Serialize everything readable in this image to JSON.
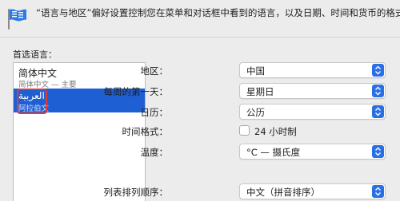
{
  "header": {
    "description": "“语言与地区”偏好设置控制您在菜单和对话框中看到的语言，以及日期、时间和货币的格式。",
    "icon": "flag-icon"
  },
  "languages": {
    "label": "首选语言：",
    "items": [
      {
        "name": "简体中文",
        "sub": "简体中文 — 主要",
        "selected": false
      },
      {
        "name": "العربية",
        "sub": "阿拉伯文",
        "selected": true
      }
    ]
  },
  "settings": {
    "region": {
      "label": "地区：",
      "value": "中国"
    },
    "first_day": {
      "label": "每周的第一天：",
      "value": "星期日"
    },
    "calendar": {
      "label": "日历：",
      "value": "公历"
    },
    "time_format": {
      "label": "时间格式：",
      "value": "24 小时制",
      "checked": false
    },
    "temperature": {
      "label": "温度：",
      "value": "°C — 摄氏度"
    },
    "sort_order": {
      "label": "列表排列顺序：",
      "value": "中文（拼音排序）"
    }
  },
  "colors": {
    "selection": "#1f5fd4",
    "stepper": "#2a6fe6",
    "annotation": "#e23b33"
  }
}
